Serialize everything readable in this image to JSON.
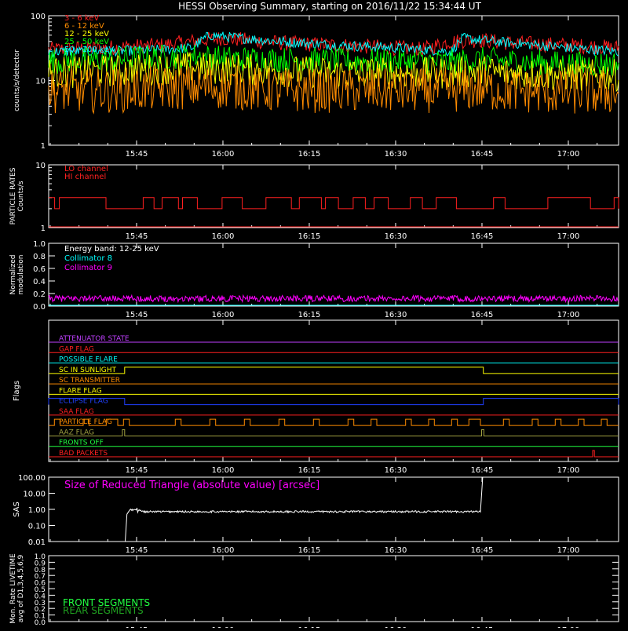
{
  "title": "HESSI Observing Summary, starting on 2016/11/22 15:34:44 UT",
  "time_ticks": [
    "15:45",
    "16:00",
    "16:15",
    "16:30",
    "16:45",
    "17:00"
  ],
  "time_tick_minutes": [
    15.27,
    30.27,
    45.27,
    60.27,
    75.27,
    90.27
  ],
  "time_range_minutes": [
    0,
    99
  ],
  "colors": {
    "axis": "#ffffff",
    "red": "#ff2020",
    "orange": "#ff8c00",
    "yellow": "#ffff00",
    "green": "#00ff00",
    "cyan": "#00ffff",
    "magenta": "#ff00ff",
    "blue": "#2040ff",
    "purple": "#c040ff",
    "olive": "#a0a040",
    "lime": "#20ff40",
    "darkgreen": "#20a020",
    "white": "#ffffff"
  },
  "chart_data": [
    {
      "type": "line",
      "panel": "count-rates",
      "ylabel": "counts/s/detector",
      "yscale": "log",
      "ylim": [
        1,
        100
      ],
      "yticks": [
        "1",
        "10",
        "100"
      ],
      "legend_position": "top-left",
      "series": [
        {
          "name": "3 - 6 keV",
          "color": "#ff2020",
          "x": [
            0,
            10,
            20,
            25,
            30,
            40,
            50,
            60,
            65,
            70,
            75,
            80,
            90,
            99
          ],
          "y": [
            30,
            32,
            35,
            40,
            45,
            38,
            35,
            32,
            30,
            40,
            42,
            38,
            35,
            32
          ]
        },
        {
          "name": "6 - 12 keV",
          "color": "#ff8c00",
          "x": [
            0,
            10,
            20,
            25,
            30,
            40,
            50,
            60,
            70,
            75,
            80,
            90,
            99
          ],
          "y": [
            7,
            7,
            7.5,
            8,
            8,
            7,
            7,
            7,
            7,
            7.5,
            7,
            6.5,
            6.5
          ]
        },
        {
          "name": "12 - 25 keV",
          "color": "#ffff00",
          "x": [
            0,
            10,
            20,
            25,
            30,
            40,
            50,
            60,
            70,
            75,
            80,
            90,
            99
          ],
          "y": [
            13,
            14,
            15,
            16,
            15,
            14,
            13,
            13,
            13,
            14,
            13,
            12,
            12
          ]
        },
        {
          "name": "25 - 50 keV",
          "color": "#00ff00",
          "x": [
            0,
            10,
            20,
            25,
            30,
            40,
            50,
            60,
            70,
            75,
            80,
            90,
            99
          ],
          "y": [
            20,
            21,
            23,
            24,
            22,
            21,
            20,
            20,
            19,
            21,
            20,
            18,
            18
          ]
        },
        {
          "name": "50 - 100 keV",
          "color": "#00ffff",
          "x": [
            0,
            10,
            20,
            25,
            28,
            30,
            40,
            50,
            60,
            65,
            70,
            72,
            75,
            80,
            90,
            99
          ],
          "y": [
            28,
            28,
            30,
            32,
            50,
            48,
            40,
            35,
            32,
            30,
            28,
            45,
            42,
            38,
            32,
            28
          ]
        }
      ]
    },
    {
      "type": "line",
      "panel": "particle-rates",
      "ylabel": "PARTICLE RATES\nCounts/s",
      "yscale": "log",
      "ylim": [
        1,
        10
      ],
      "yticks": [
        "1",
        "10"
      ],
      "series": [
        {
          "name": "LO channel",
          "color": "#ff2020",
          "levels": [
            2,
            3
          ],
          "y_level_low": 2,
          "y_level_high": 3
        },
        {
          "name": "HI channel",
          "color": "#ff2020",
          "y": [
            1
          ]
        }
      ]
    },
    {
      "type": "line",
      "panel": "modulation",
      "ylabel": "Normalized\nmodulation",
      "ylim": [
        0.0,
        1.0
      ],
      "yticks": [
        "0.0",
        "0.2",
        "0.4",
        "0.6",
        "0.8",
        "1.0"
      ],
      "annotation": "Energy band: 12-25 keV",
      "series": [
        {
          "name": "Collimator 8",
          "color": "#00ffff",
          "y_mean": 0.0
        },
        {
          "name": "Collimator 9",
          "color": "#ff00ff",
          "y_mean": 0.12
        }
      ]
    },
    {
      "type": "line",
      "panel": "flags",
      "ylabel": "Flags",
      "series": [
        {
          "name": "ATTENUATOR STATE",
          "color": "#c040ff",
          "on": []
        },
        {
          "name": "GAP FLAG",
          "color": "#ff2020",
          "on": []
        },
        {
          "name": "POSSIBLE FLARE",
          "color": "#00ffff",
          "on": []
        },
        {
          "name": "SC IN SUNLIGHT",
          "color": "#ffff00",
          "on": [
            [
              13.2,
              75.5
            ]
          ]
        },
        {
          "name": "SC TRANSMITTER",
          "color": "#ff8c00",
          "on": []
        },
        {
          "name": "FLARE FLAG",
          "color": "#ffff00",
          "on": []
        },
        {
          "name": "ECLIPSE FLAG",
          "color": "#2040ff",
          "on": [
            [
              0,
              13.2
            ],
            [
              75.5,
              99
            ]
          ]
        },
        {
          "name": "SAA FLAG",
          "color": "#ff2020",
          "on": []
        },
        {
          "name": "PARTICLE FLAG",
          "color": "#ff8c00",
          "on": [
            [
              1,
              2
            ],
            [
              6,
              7
            ],
            [
              10,
              12
            ],
            [
              13,
              14
            ],
            [
              22,
              23
            ],
            [
              28,
              29
            ],
            [
              34,
              35
            ],
            [
              40,
              41
            ],
            [
              46,
              47
            ],
            [
              52,
              53
            ],
            [
              56,
              57
            ],
            [
              62,
              63
            ],
            [
              66,
              67
            ],
            [
              70,
              71
            ],
            [
              73,
              75
            ],
            [
              79,
              80
            ],
            [
              84,
              85
            ],
            [
              88,
              89
            ],
            [
              92,
              93
            ],
            [
              96,
              97
            ]
          ]
        },
        {
          "name": "AAZ FLAG",
          "color": "#a0a040",
          "on": [
            [
              12.8,
              13.2
            ],
            [
              75.2,
              75.6
            ]
          ]
        },
        {
          "name": "FRONTS OFF",
          "color": "#20ff40",
          "on": []
        },
        {
          "name": "BAD PACKETS",
          "color": "#ff2020",
          "on": [
            [
              94.5,
              94.8
            ]
          ]
        }
      ]
    },
    {
      "type": "line",
      "panel": "sas",
      "ylabel": "SAS",
      "yscale": "log",
      "ylim": [
        0.01,
        100
      ],
      "yticks": [
        "0.01",
        "0.10",
        "1.00",
        "10.00",
        "100.00"
      ],
      "annotation": "Size of Reduced Triangle (absolute value) [arcsec]",
      "series": [
        {
          "name": "",
          "color": "#ffffff",
          "x": [
            13.3,
            13.6,
            14,
            20,
            40,
            60,
            75,
            75.4
          ],
          "y": [
            0.01,
            0.5,
            0.7,
            0.75,
            0.72,
            0.7,
            0.75,
            100
          ]
        }
      ]
    },
    {
      "type": "line",
      "panel": "livetime",
      "ylabel": "Mon. Rate LIVETIME\navg of D1,3,4,5,6,9",
      "ylim": [
        0.0,
        1.0
      ],
      "yticks": [
        "0.0",
        "0.1",
        "0.2",
        "0.3",
        "0.4",
        "0.5",
        "0.6",
        "0.7",
        "0.8",
        "0.9",
        "1.0"
      ],
      "series": [
        {
          "name": "FRONT SEGMENTS",
          "color": "#20ff40",
          "y": []
        },
        {
          "name": "REAR SEGMENTS",
          "color": "#20a020",
          "y": []
        }
      ]
    }
  ]
}
